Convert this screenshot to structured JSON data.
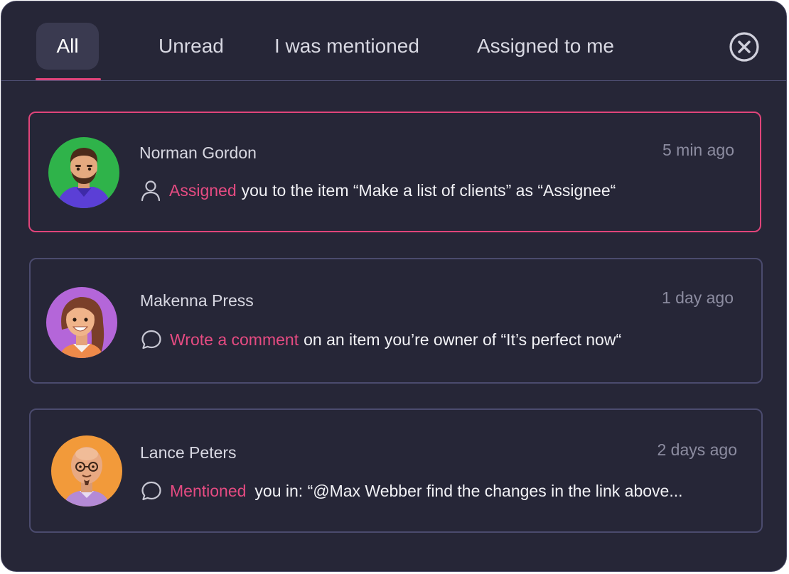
{
  "tabs": [
    {
      "label": "All",
      "active": true
    },
    {
      "label": "Unread",
      "active": false
    },
    {
      "label": "I was mentioned",
      "active": false
    },
    {
      "label": "Assigned to me",
      "active": false
    }
  ],
  "close_icon": "close-circle-icon",
  "colors": {
    "accent": "#e64b82",
    "background": "#262637",
    "card_border": "#4b4b6e"
  },
  "notifications": [
    {
      "name": "Norman Gordon",
      "time": "5 min ago",
      "icon": "user-icon",
      "action": "Assigned",
      "text": "you to the item “Make a list of clients” as “Assignee“",
      "avatar_color": "#2fb34a",
      "highlighted": true
    },
    {
      "name": "Makenna Press",
      "time": "1 day ago",
      "icon": "comment-icon",
      "action": "Wrote a comment",
      "text": "on an item you’re owner of “It’s perfect now“",
      "avatar_color": "#b466d9",
      "highlighted": false
    },
    {
      "name": "Lance Peters",
      "time": "2 days ago",
      "icon": "comment-icon",
      "action": "Mentioned",
      "text": "you in: “@Max Webber find the changes in the link above...",
      "avatar_color": "#f29a3a",
      "highlighted": false
    }
  ]
}
